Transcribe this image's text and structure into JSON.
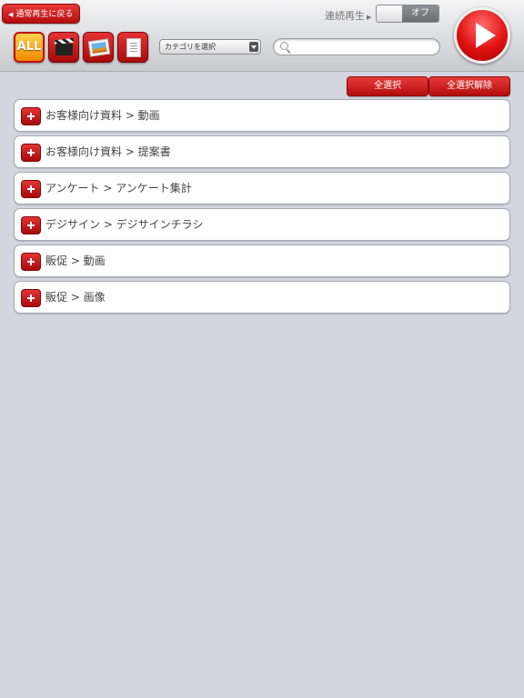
{
  "header": {
    "back_label": "通常再生に戻る",
    "continuous_label": "連続再生",
    "toggle_off_label": "オフ",
    "all_label": "ALL",
    "category_select_value": "カテゴリを選択",
    "search_placeholder": ""
  },
  "actions": {
    "select_all": "全選択",
    "deselect_all": "全選択解除"
  },
  "list": [
    {
      "label": "お客様向け資料 > 動画"
    },
    {
      "label": "お客様向け資料 > 提案書"
    },
    {
      "label": "アンケート > アンケート集計"
    },
    {
      "label": "デジサイン > デジサインチラシ"
    },
    {
      "label": "販促 > 動画"
    },
    {
      "label": "販促 > 画像"
    }
  ],
  "colors": {
    "accent_red": "#d21c1c",
    "background": "#d3d6de",
    "all_orange": "#f6a500"
  },
  "icons": [
    "chevron-left-icon",
    "play-icon",
    "movie-icon",
    "image-icon",
    "document-icon",
    "search-icon",
    "plus-icon"
  ]
}
